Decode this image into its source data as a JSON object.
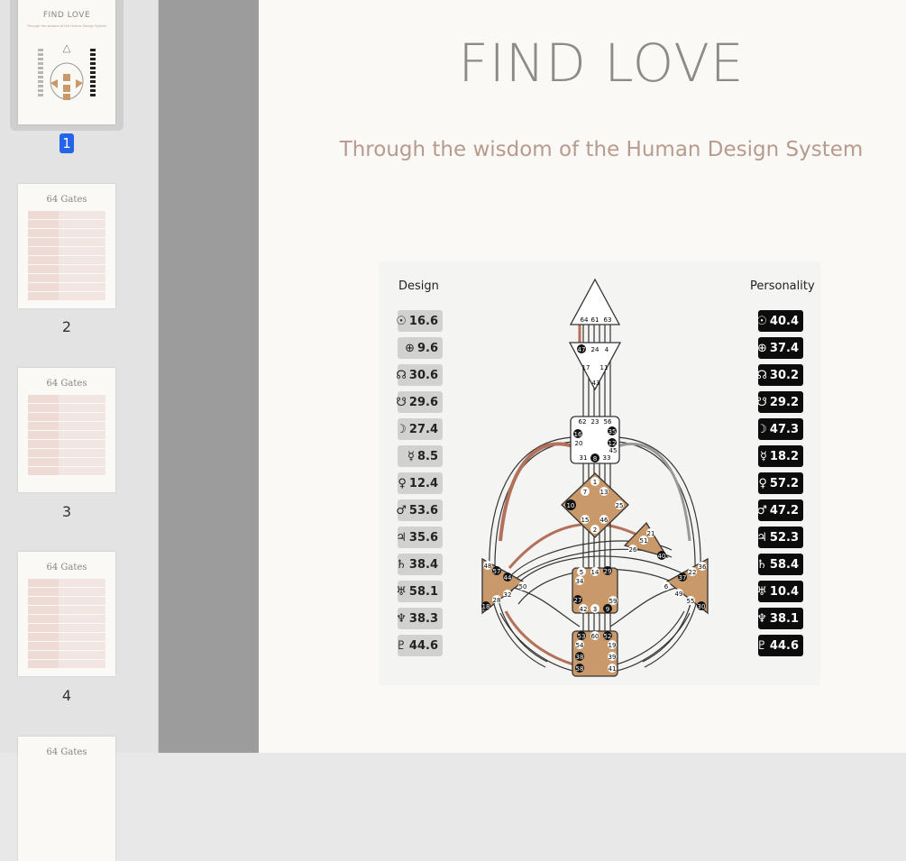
{
  "sidebar": {
    "thumbs": [
      {
        "page": "1",
        "title": "FIND LOVE",
        "subtitle": "Through the wisdom of the Human Design System"
      },
      {
        "page": "2",
        "title": "64 Gates"
      },
      {
        "page": "3",
        "title": "64 Gates"
      },
      {
        "page": "4",
        "title": "64 Gates"
      },
      {
        "page": "",
        "title": "64 Gates"
      }
    ]
  },
  "page": {
    "title": "FIND LOVE",
    "subtitle": "Through the wisdom of the Human Design System"
  },
  "chart": {
    "design_label": "Design",
    "personality_label": "Personality",
    "design": [
      {
        "sym": "☉",
        "val": "16.6"
      },
      {
        "sym": "⊕",
        "val": "9.6"
      },
      {
        "sym": "☊",
        "val": "30.6"
      },
      {
        "sym": "☋",
        "val": "29.6"
      },
      {
        "sym": "☽",
        "val": "27.4"
      },
      {
        "sym": "☿",
        "val": "8.5"
      },
      {
        "sym": "♀",
        "val": "12.4"
      },
      {
        "sym": "♂",
        "val": "53.6"
      },
      {
        "sym": "♃",
        "val": "35.6"
      },
      {
        "sym": "♄",
        "val": "38.4"
      },
      {
        "sym": "♅",
        "val": "58.1"
      },
      {
        "sym": "♆",
        "val": "38.3"
      },
      {
        "sym": "♇",
        "val": "44.6"
      }
    ],
    "personality": [
      {
        "sym": "☉",
        "val": "40.4"
      },
      {
        "sym": "⊕",
        "val": "37.4"
      },
      {
        "sym": "☊",
        "val": "30.2"
      },
      {
        "sym": "☋",
        "val": "29.2"
      },
      {
        "sym": "☽",
        "val": "47.3"
      },
      {
        "sym": "☿",
        "val": "18.2"
      },
      {
        "sym": "♀",
        "val": "57.2"
      },
      {
        "sym": "♂",
        "val": "47.2"
      },
      {
        "sym": "♃",
        "val": "52.3"
      },
      {
        "sym": "♄",
        "val": "58.4"
      },
      {
        "sym": "♅",
        "val": "10.4"
      },
      {
        "sym": "♆",
        "val": "38.1"
      },
      {
        "sym": "♇",
        "val": "44.6"
      }
    ],
    "colors": {
      "defined": "#c9996a",
      "undefined": "#ffffff",
      "design_line": "#b3705a",
      "personality_line": "#111111"
    },
    "gates": {
      "head": [
        "64",
        "61",
        "63"
      ],
      "ajna": [
        "47",
        "24",
        "4",
        "17",
        "11",
        "43"
      ],
      "throat": [
        "62",
        "23",
        "56",
        "16",
        "35",
        "12",
        "20",
        "45",
        "31",
        "8",
        "33"
      ],
      "g": [
        "1",
        "7",
        "13",
        "10",
        "25",
        "15",
        "46",
        "2"
      ],
      "ego": [
        "21",
        "51",
        "26",
        "40"
      ],
      "spleen": [
        "48",
        "57",
        "44",
        "50",
        "32",
        "28",
        "18"
      ],
      "sacral": [
        "5",
        "14",
        "29",
        "34",
        "27",
        "59",
        "42",
        "3",
        "9"
      ],
      "solar": [
        "36",
        "22",
        "37",
        "6",
        "49",
        "55",
        "30"
      ],
      "root": [
        "53",
        "60",
        "52",
        "54",
        "19",
        "38",
        "39",
        "58",
        "41"
      ]
    }
  }
}
